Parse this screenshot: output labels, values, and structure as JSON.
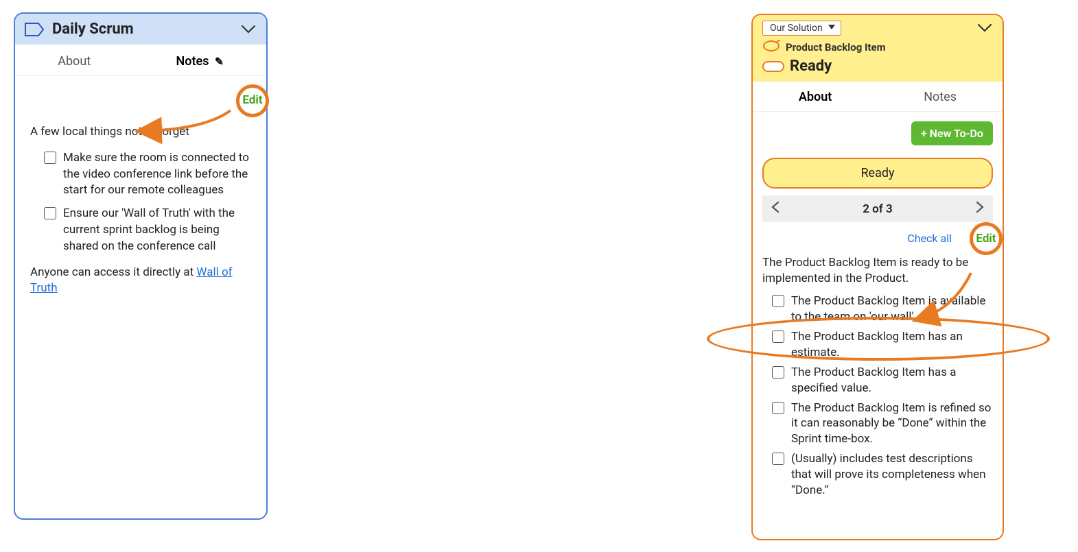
{
  "left": {
    "title": "Daily Scrum",
    "tabs": {
      "about": "About",
      "notes": "Notes",
      "notes_icon": "✎"
    },
    "edit_label": "Edit",
    "intro": "A few local things not to forget",
    "items": [
      "Make sure the room is connected to the video conference link before the start for our remote colleagues",
      "Ensure our 'Wall of Truth' with the current sprint backlog is being shared on the conference call"
    ],
    "footer_pre": "Anyone can access it directly at ",
    "footer_link": "Wall of Truth"
  },
  "right": {
    "solution_label": "Our Solution",
    "pbi_label": "Product Backlog Item",
    "title": "Ready",
    "tabs": {
      "about": "About",
      "notes": "Notes"
    },
    "new_todo_label": "+ New To-Do",
    "status_pill": "Ready",
    "pager_text": "2 of 3",
    "check_all": "Check all",
    "edit_label": "Edit",
    "intro": "The Product Backlog Item is ready to be implemented in the Product.",
    "items": [
      "The Product Backlog Item is available to the team on 'our wall'",
      "The Product Backlog Item has an estimate.",
      "The Product Backlog Item has a specified value.",
      "The Product Backlog Item is refined so it can reasonably be “Done” within the Sprint time-box.",
      "(Usually) includes test descriptions that will prove its completeness when “Done.”"
    ]
  }
}
